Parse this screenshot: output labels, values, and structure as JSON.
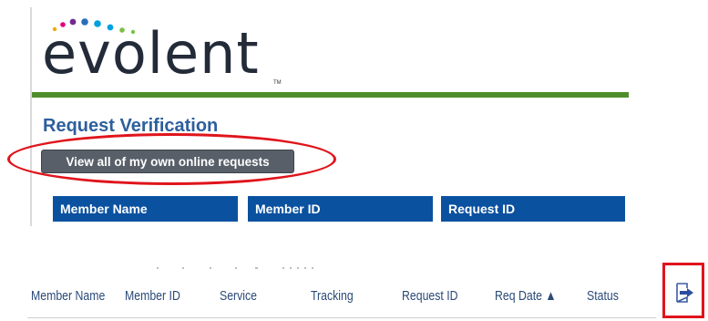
{
  "logo": {
    "text": "evolent",
    "trademark": "TM",
    "dot_colors": [
      "#f2a900",
      "#e4007c",
      "#6f2c91",
      "#2a6ebb",
      "#00a1de",
      "#7ac143"
    ]
  },
  "colors": {
    "accent_green": "#4e8d2b",
    "title_blue": "#2d5f9c",
    "header_blue": "#0a51a0",
    "button_gray": "#585f69",
    "highlight_red": "#e0141b"
  },
  "section": {
    "title": "Request Verification",
    "view_button": "View all of my own online requests"
  },
  "search_headers": [
    "Member Name",
    "Member ID",
    "Request ID"
  ],
  "results_table": {
    "columns": [
      "Member Name",
      "Member ID",
      "Service",
      "Tracking",
      "Request ID",
      "Req Date ▲",
      "Status"
    ]
  },
  "icons": {
    "exit": "exit-icon"
  }
}
